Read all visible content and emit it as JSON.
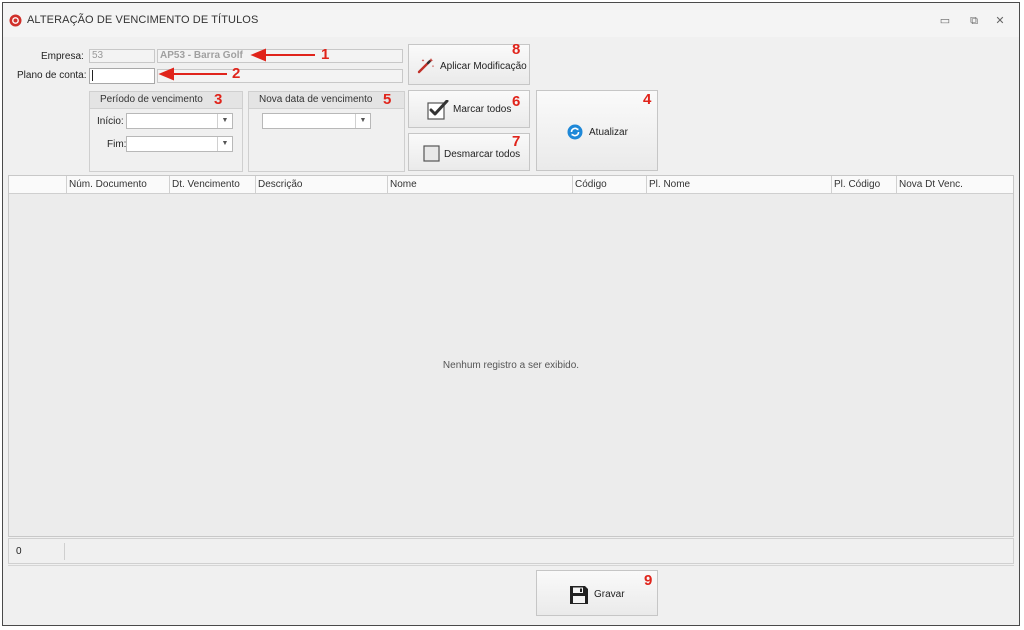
{
  "window": {
    "title": "ALTERAÇÃO DE VENCIMENTO DE TÍTULOS",
    "controls": {
      "minimize": "▭",
      "restore": "⧉",
      "close": "✕"
    }
  },
  "form": {
    "empresa_label": "Empresa:",
    "empresa_code": "53",
    "empresa_name": "AP53 - Barra Golf",
    "plano_label": "Plano de conta:",
    "plano_value": "",
    "plano_desc": ""
  },
  "periodo": {
    "title": "Período de vencimento",
    "inicio_label": "Início:",
    "inicio_value": "",
    "fim_label": "Fim:",
    "fim_value": ""
  },
  "nova_data": {
    "title": "Nova data de vencimento",
    "value": ""
  },
  "buttons": {
    "aplicar": "Aplicar Modificação",
    "marcar": "Marcar todos",
    "desmarcar": "Desmarcar todos",
    "atualizar": "Atualizar",
    "gravar": "Gravar"
  },
  "grid": {
    "columns": [
      "",
      "Núm. Documento",
      "Dt. Vencimento",
      "Descrição",
      "Nome",
      "Código",
      "Pl. Nome",
      "Pl. Código",
      "Nova Dt Venc."
    ],
    "empty_message": "Nenhum registro a ser exibido."
  },
  "status": {
    "count": "0"
  },
  "annotations": [
    "1",
    "2",
    "3",
    "4",
    "5",
    "6",
    "7",
    "8",
    "9"
  ],
  "colors": {
    "annotation": "#e0241b",
    "refresh_icon": "#1e88d8",
    "app_icon": "#d0302a"
  },
  "icons": {
    "app": "app-logo-icon",
    "aplicar": "magic-wand-icon",
    "marcar": "checkbox-checked-icon",
    "desmarcar": "checkbox-empty-icon",
    "atualizar": "refresh-icon",
    "gravar": "save-disk-icon",
    "combo_arrow": "chevron-down-icon"
  }
}
